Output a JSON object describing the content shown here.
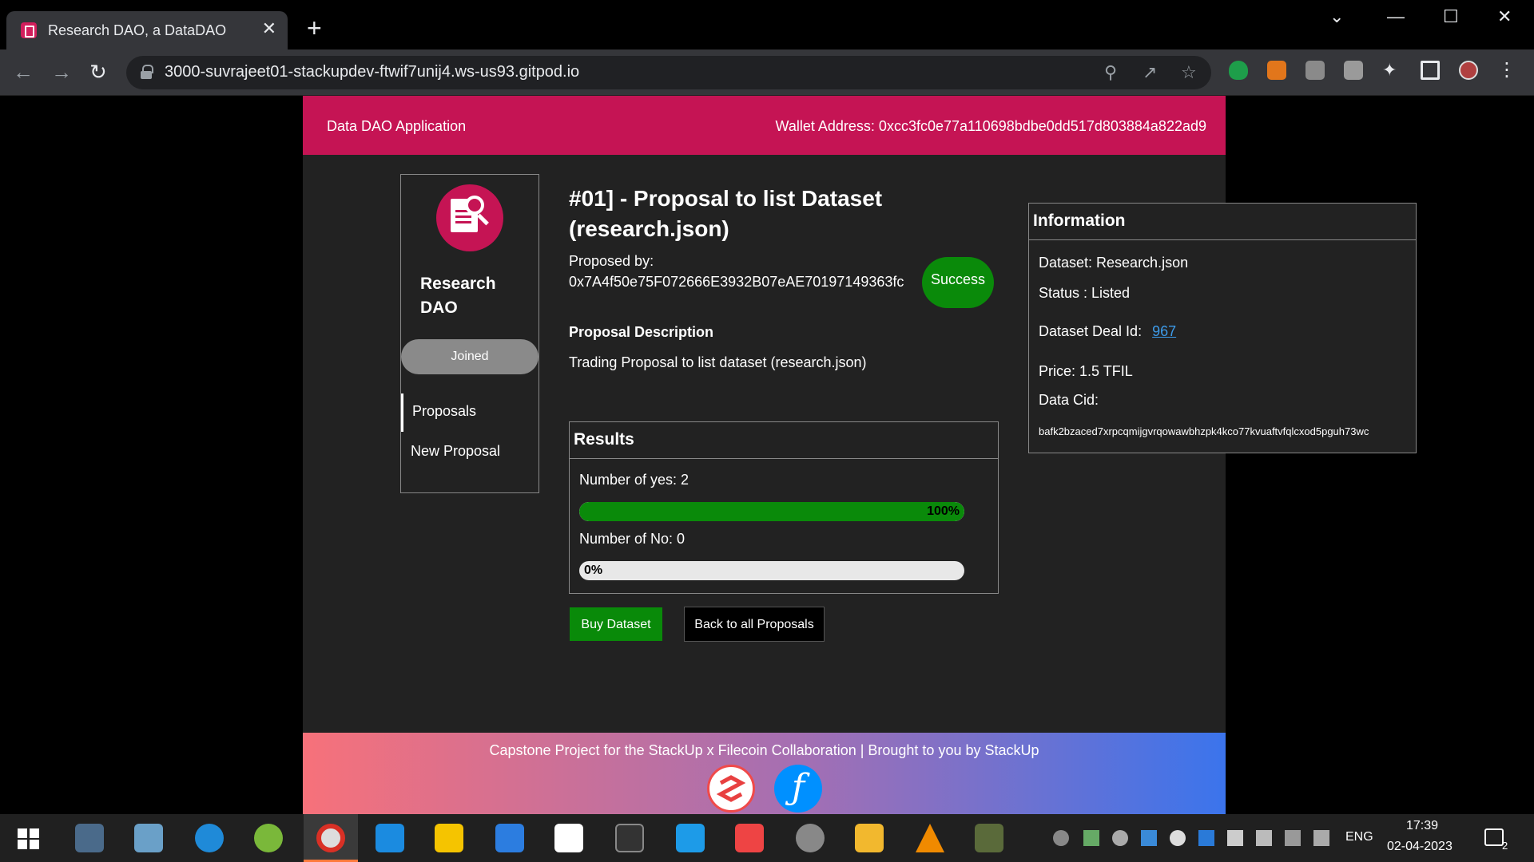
{
  "browser": {
    "tab_title": "Research DAO, a DataDAO",
    "tab_close": "✕",
    "new_tab": "+",
    "url": "3000-suvrajeet01-stackupdev-ftwif7unij4.ws-us93.gitpod.io",
    "controls": {
      "dropdown": "⌄",
      "minimize": "—",
      "maximize": "☐",
      "close": "✕"
    },
    "nav": {
      "back": "←",
      "forward": "→",
      "reload": "↻"
    },
    "omnibox_icons": [
      "zoom-icon",
      "share-icon",
      "star-icon"
    ],
    "extension_icons": [
      "shield-extension-icon",
      "metamask-fox-icon",
      "extension-icon-1",
      "extension-icon-2",
      "puzzle-extensions-icon",
      "sidebar-icon",
      "profile-avatar",
      "menu-kebab-icon"
    ]
  },
  "app": {
    "title": "Data DAO Application",
    "wallet": "Wallet Address: 0xcc3fc0e77a110698bdbe0dd517d803884a822ad9",
    "accent_color": "#c51454"
  },
  "sidebar": {
    "dao_name": "Research DAO",
    "joined_label": "Joined",
    "items": [
      {
        "label": "Proposals",
        "active": true
      },
      {
        "label": "New Proposal",
        "active": false
      }
    ]
  },
  "proposal": {
    "title": "#01] - Proposal to list Dataset (research.json)",
    "proposed_by_label": "Proposed by:",
    "proposed_by": "0x7A4f50e75F072666E3932B07eAE70197149363fc",
    "status_badge": "Success",
    "description_heading": "Proposal Description",
    "description": "Trading Proposal to list dataset (research.json)"
  },
  "results": {
    "heading": "Results",
    "yes_label": "Number of yes: 2",
    "yes_percent": 100,
    "yes_percent_text": "100%",
    "no_label": "Number of No: 0",
    "no_percent": 0,
    "no_percent_text": "0%"
  },
  "actions": {
    "buy_label": "Buy Dataset",
    "back_label": "Back to all Proposals"
  },
  "information": {
    "heading": "Information",
    "dataset": "Dataset: Research.json",
    "status": "Status : Listed",
    "deal_id_label": "Dataset Deal Id:",
    "deal_id": "967",
    "price": "Price: 1.5 TFIL",
    "cid_label": "Data Cid:",
    "cid": "bafk2bzaced7xrpcqmijgvrqowawbhzpk4kco77kvuaftvfqlcxod5pguh73wc"
  },
  "footer": {
    "text": "Capstone Project for the StackUp x Filecoin Collaboration | Brought to you by StackUp",
    "logos": [
      "stackup-logo",
      "filecoin-logo"
    ],
    "filecoin_glyph": "ƒ"
  },
  "taskbar": {
    "apps": [
      "windows-start-icon",
      "calculator-icon",
      "notepad-icon",
      "edge-icon",
      "app-icon",
      "chrome-icon",
      "vscode-icon",
      "sticky-notes-icon",
      "todo-icon",
      "notion-icon",
      "terminal-icon",
      "app-icon-blue",
      "store-icon",
      "settings-icon",
      "file-explorer-icon",
      "vlc-icon",
      "game-icon"
    ],
    "language": "ENG",
    "time": "17:39",
    "date": "02-04-2023",
    "notification_count": "2"
  }
}
